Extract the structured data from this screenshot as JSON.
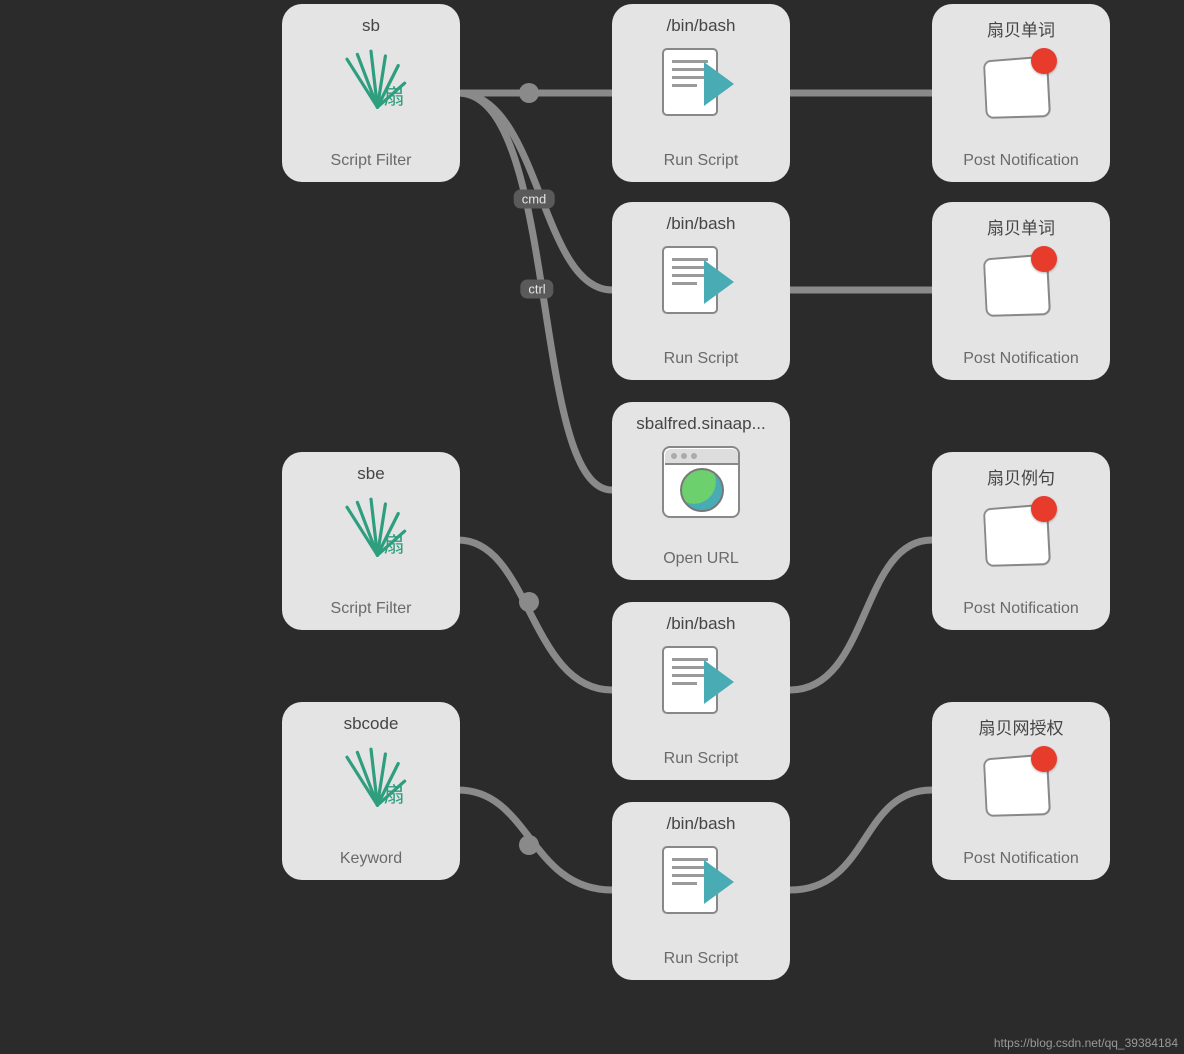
{
  "nodes": {
    "sb": {
      "title": "sb",
      "subtitle": "Script Filter"
    },
    "sbe": {
      "title": "sbe",
      "subtitle": "Script Filter"
    },
    "sbcode": {
      "title": "sbcode",
      "subtitle": "Keyword"
    },
    "run1": {
      "title": "/bin/bash",
      "subtitle": "Run Script"
    },
    "run2": {
      "title": "/bin/bash",
      "subtitle": "Run Script"
    },
    "openurl": {
      "title": "sbalfred.sinaap...",
      "subtitle": "Open URL"
    },
    "run3": {
      "title": "/bin/bash",
      "subtitle": "Run Script"
    },
    "run4": {
      "title": "/bin/bash",
      "subtitle": "Run Script"
    },
    "notif1": {
      "title": "扇贝单词",
      "subtitle": "Post Notification"
    },
    "notif2": {
      "title": "扇贝单词",
      "subtitle": "Post Notification"
    },
    "notif3": {
      "title": "扇贝例句",
      "subtitle": "Post Notification"
    },
    "notif4": {
      "title": "扇贝网授权",
      "subtitle": "Post Notification"
    }
  },
  "modifiers": {
    "cmd": "cmd",
    "ctrl": "ctrl"
  },
  "leaf_glyph": "扇",
  "watermark": "https://blog.csdn.net/qq_39384184"
}
